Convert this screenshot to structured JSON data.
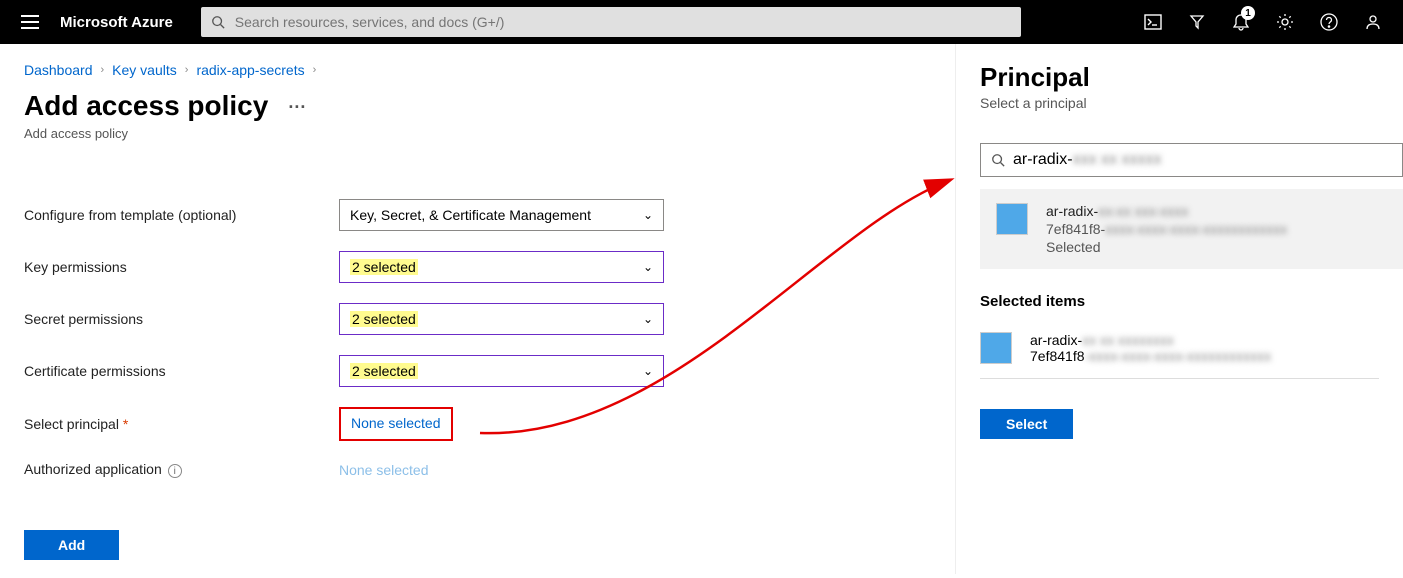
{
  "topbar": {
    "brand": "Microsoft Azure",
    "search_placeholder": "Search resources, services, and docs (G+/)",
    "notification_count": "1"
  },
  "breadcrumb": {
    "items": [
      "Dashboard",
      "Key vaults",
      "radix-app-secrets"
    ]
  },
  "page": {
    "title": "Add access policy",
    "subtitle": "Add access policy"
  },
  "form": {
    "template_label": "Configure from template (optional)",
    "template_value": "Key, Secret, & Certificate Management",
    "key_perm_label": "Key permissions",
    "key_perm_value": "2 selected",
    "secret_perm_label": "Secret permissions",
    "secret_perm_value": "2 selected",
    "cert_perm_label": "Certificate permissions",
    "cert_perm_value": "2 selected",
    "principal_label": "Select principal",
    "principal_value": "None selected",
    "auth_app_label": "Authorized application",
    "auth_app_value": "None selected",
    "add_button": "Add"
  },
  "panel": {
    "title": "Principal",
    "subtitle": "Select a principal",
    "search_value_visible": "ar-radix-",
    "search_value_blur": "xxx xx xxxxx",
    "result": {
      "name_visible": "ar-radix-",
      "name_blur": "xx-xx xxx-xxxx",
      "guid_visible": "7ef841f8-",
      "guid_blur": "xxxx-xxxx-xxxx-xxxxxxxxxxxx",
      "status": "Selected"
    },
    "selected_items_label": "Selected items",
    "selected": {
      "name_visible": "ar-radix-",
      "name_blur": "xx xx xxxxxxxx",
      "guid_visible": "7ef841f8",
      "guid_blur": "-xxxx-xxxx-xxxx-xxxxxxxxxxxx"
    },
    "select_button": "Select"
  }
}
